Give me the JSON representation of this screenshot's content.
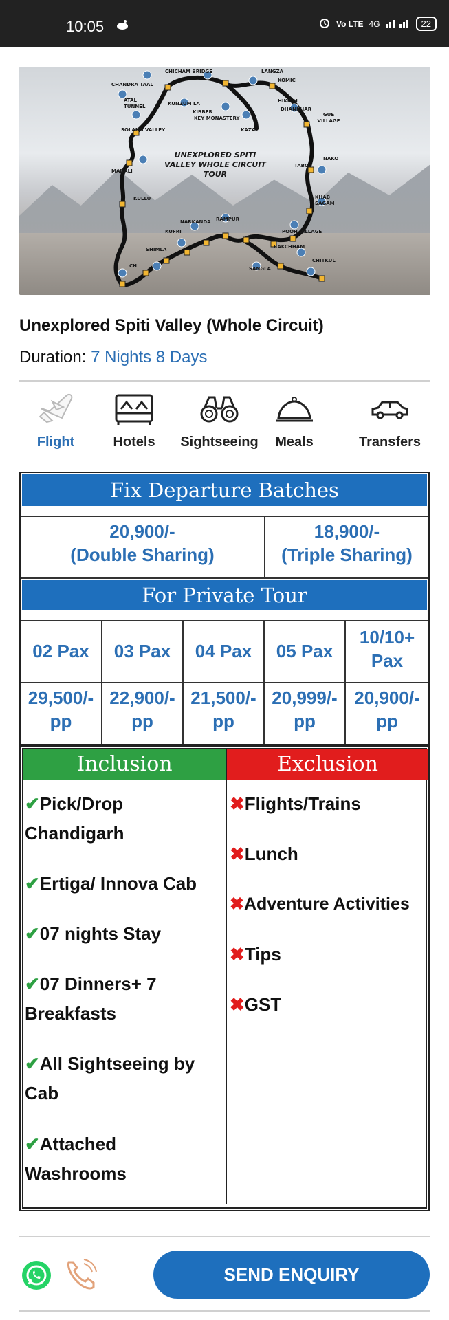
{
  "status_bar": {
    "time": "10:05",
    "battery": "22",
    "network": "4G"
  },
  "map": {
    "title_line1": "UNEXPLORED SPITI",
    "title_line2": "VALLEY WHOLE CIRCUIT",
    "title_line3": "TOUR",
    "places": [
      "CHICHAM BRIDGE",
      "LANGZA",
      "KOMIC",
      "CHANDRA TAAL",
      "HIKKIM",
      "ATAL TUNNEL",
      "KUNZUM LA",
      "DHANKHAR",
      "KIBBER",
      "KEY MONASTERY",
      "GUE VILLAGE",
      "SOLANG VALLEY",
      "KAZA",
      "NAKO",
      "TABO",
      "MANALI",
      "KHAB SAGAM",
      "KULLU",
      "NARKANDA",
      "RAMPUR",
      "POOH VILLAGE",
      "KUFRI",
      "RAKCHHAM",
      "SHIMLA",
      "CHITKUL",
      "SANGLA",
      "CH"
    ]
  },
  "package": {
    "title": "Unexplored Spiti Valley (Whole Circuit)",
    "duration_label": "Duration:",
    "duration_value": "7 Nights 8 Days"
  },
  "features": [
    {
      "label": "Flight",
      "icon": "flight-icon"
    },
    {
      "label": "Hotels",
      "icon": "hotel-bed-icon"
    },
    {
      "label": "Sightseeing",
      "icon": "binoculars-icon"
    },
    {
      "label": "Meals",
      "icon": "meal-cloche-icon"
    },
    {
      "label": "Transfers",
      "icon": "car-icon"
    }
  ],
  "pricing": {
    "fixed_heading": "Fix Departure Batches",
    "double_price": "20,900/-",
    "double_label": "(Double Sharing)",
    "triple_price": "18,900/-",
    "triple_label": "(Triple Sharing)",
    "private_heading": "For Private Tour",
    "private": [
      {
        "pax": "02 Pax",
        "price": "29,500/-",
        "unit": "pp"
      },
      {
        "pax": "03 Pax",
        "price": "22,900/-",
        "unit": "pp"
      },
      {
        "pax": "04 Pax",
        "price": "21,500/-",
        "unit": "pp"
      },
      {
        "pax": "05 Pax",
        "price": "20,999/-",
        "unit": "pp"
      },
      {
        "pax_line1": "10/10+",
        "pax_line2": "Pax",
        "price": "20,900/-",
        "unit": "pp"
      }
    ]
  },
  "inclusion": {
    "heading": "Inclusion",
    "items": [
      {
        "line1": "Pick/Drop",
        "line2": "Chandigarh"
      },
      {
        "line1": "Ertiga/ Innova Cab"
      },
      {
        "line1": "07 nights Stay"
      },
      {
        "line1": "07 Dinners+ 7",
        "line2": "Breakfasts"
      },
      {
        "line1": "All Sightseeing by",
        "line2": "Cab"
      },
      {
        "line1": "Attached",
        "line2": "Washrooms"
      }
    ]
  },
  "exclusion": {
    "heading": "Exclusion",
    "items": [
      "Flights/Trains",
      "Lunch",
      "Adventure Activities",
      "Tips",
      "GST"
    ]
  },
  "cta": {
    "enquiry_label": "SEND ENQUIRY"
  },
  "colors": {
    "accent": "#1e6fbd",
    "inclusion": "#2ea043",
    "exclusion": "#e11d1d"
  }
}
